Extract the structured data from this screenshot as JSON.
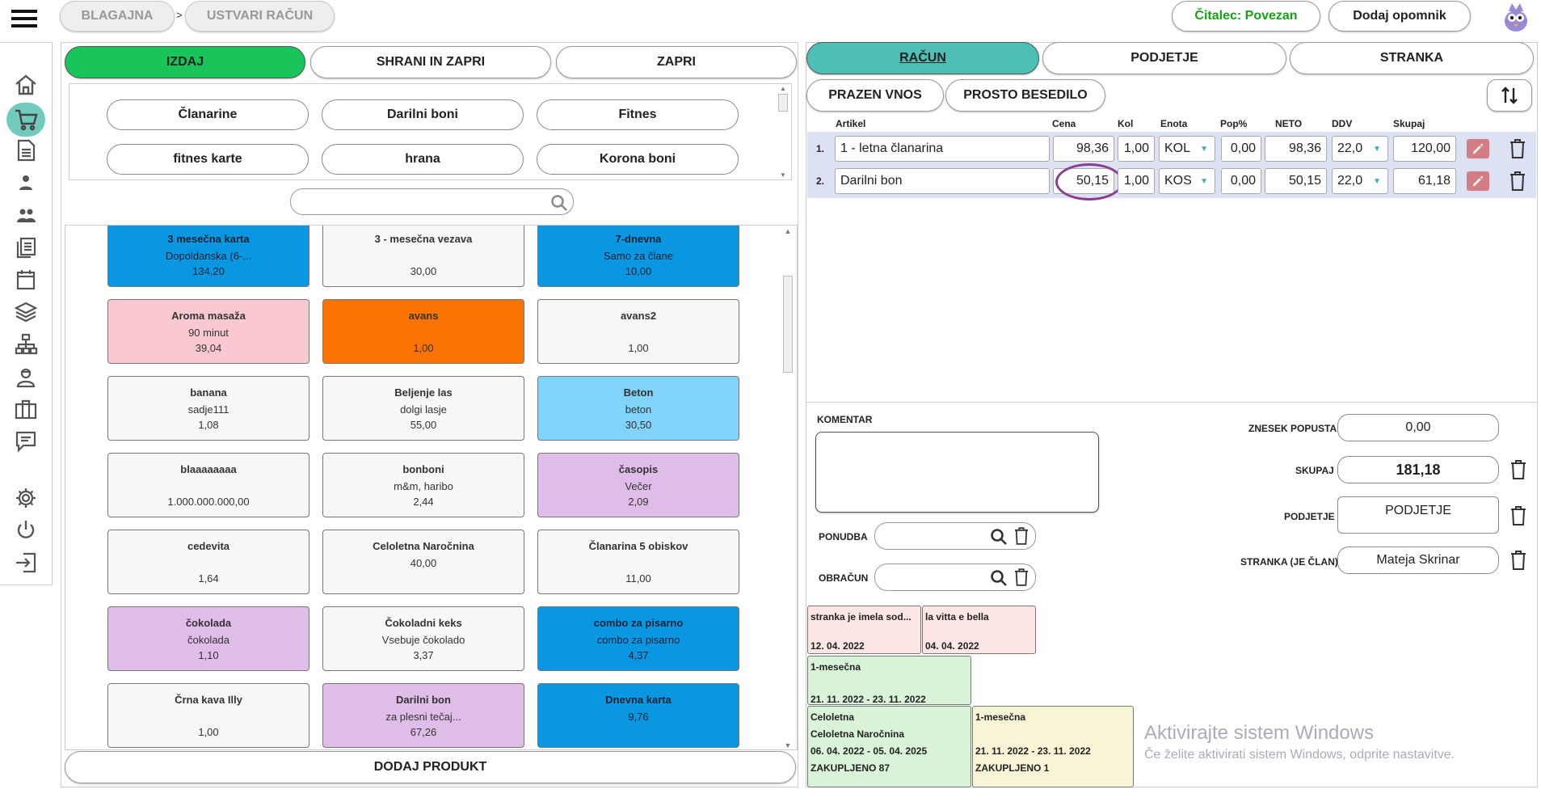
{
  "topbar": {
    "breadcrumb": [
      "BLAGAJNA",
      "USTVARI RAČUN"
    ],
    "separator": ">",
    "reader_status": "Čitalec: Povezan",
    "reminder_button": "Dodaj opomnik"
  },
  "colors": {
    "accent_green": "#19c45a",
    "accent_teal": "#4dbfb5",
    "reader_text": "#18a018"
  },
  "sidebar": {
    "icons": [
      "home-icon",
      "cart-icon",
      "document-icon",
      "person-icon",
      "people-icon",
      "copy-icon",
      "calendar-icon",
      "layers-icon",
      "sitemap-icon",
      "worker-icon",
      "briefcase-icon",
      "chat-icon",
      "gear-icon",
      "power-icon",
      "logout-icon"
    ]
  },
  "left": {
    "actions": {
      "issue": "IZDAJ",
      "save_close": "SHRANI IN ZAPRI",
      "close": "ZAPRI"
    },
    "categories": [
      "Članarine",
      "Darilni boni",
      "Fitnes",
      "fitnes karte",
      "hrana",
      "Korona boni"
    ],
    "search_value": "",
    "products": [
      {
        "name": "3 mesečna karta",
        "desc": "Dopoldanska (6-...",
        "price": "134,20",
        "color": "blue"
      },
      {
        "name": "3 - mesečna vezava",
        "desc": "",
        "price": "30,00",
        "color": "white"
      },
      {
        "name": "7-dnevna",
        "desc": "Samo za člane",
        "price": "10,00",
        "color": "blue"
      },
      {
        "name": "Aroma masaža",
        "desc": "90 minut",
        "price": "39,04",
        "color": "pink"
      },
      {
        "name": "avans",
        "desc": "",
        "price": "1,00",
        "color": "orange"
      },
      {
        "name": "avans2",
        "desc": "",
        "price": "1,00",
        "color": "white"
      },
      {
        "name": "banana",
        "desc": "sadje111",
        "price": "1,08",
        "color": "white"
      },
      {
        "name": "Beljenje las",
        "desc": "dolgi lasje",
        "price": "55,00",
        "color": "white"
      },
      {
        "name": "Beton",
        "desc": "beton",
        "price": "30,50",
        "color": "lblue"
      },
      {
        "name": "blaaaaaaaa",
        "desc": "",
        "price": "1.000.000.000,00",
        "color": "white"
      },
      {
        "name": "bonboni",
        "desc": "m&m, haribo",
        "price": "2,44",
        "color": "white"
      },
      {
        "name": "časopis",
        "desc": "Večer",
        "price": "2,09",
        "color": "purple"
      },
      {
        "name": "cedevita",
        "desc": "",
        "price": "1,64",
        "color": "white"
      },
      {
        "name": "Celoletna Naročnina",
        "desc": "40,00",
        "price": "",
        "color": "white"
      },
      {
        "name": "Članarina 5 obiskov",
        "desc": "",
        "price": "11,00",
        "color": "white"
      },
      {
        "name": "čokolada",
        "desc": "čokolada",
        "price": "1,10",
        "color": "purple"
      },
      {
        "name": "Čokoladni keks",
        "desc": "Vsebuje čokolado",
        "price": "3,37",
        "color": "white"
      },
      {
        "name": "combo za pisarno",
        "desc": "combo za pisarno",
        "price": "4,37",
        "color": "blue"
      },
      {
        "name": "Črna kava Illy",
        "desc": "",
        "price": "1,00",
        "color": "white"
      },
      {
        "name": "Darilni bon",
        "desc": "za plesni tečaj...",
        "price": "67,26",
        "color": "purple"
      },
      {
        "name": "Dnevna karta",
        "desc": "9,76",
        "price": "",
        "color": "blue"
      }
    ],
    "add_product": "DODAJ PRODUKT"
  },
  "right": {
    "tabs": {
      "invoice": "RAČUN",
      "split": "PODJETJE",
      "customer": "STRANKA"
    },
    "buttons": {
      "empty_entry": "PRAZEN VNOS",
      "free_text": "PROSTO BESEDILO"
    },
    "columns": [
      "Artikel",
      "Cena",
      "Kol",
      "Enota",
      "Pop%",
      "NETO",
      "DDV",
      "Skupaj"
    ],
    "rows": [
      {
        "num": "1.",
        "article": "1 - letna članarina",
        "price": "98,36",
        "qty": "1,00",
        "unit": "KOL",
        "discount": "0,00",
        "net": "98,36",
        "vat": "22,0",
        "total": "120,00"
      },
      {
        "num": "2.",
        "article": "Darilni bon",
        "price": "50,15",
        "qty": "1,00",
        "unit": "KOS",
        "discount": "0,00",
        "net": "50,15",
        "vat": "22,0",
        "total": "61,18"
      }
    ],
    "comment_label": "KOMENTAR",
    "comment_value": "",
    "offer_label": "PONUDBA",
    "billing_label": "OBRAČUN",
    "discount_label": "ZNESEK POPUSTA",
    "discount_value": "0,00",
    "total_label": "SKUPAJ",
    "total_value": "181,18",
    "company_label": "PODJETJE",
    "company_value": "PODJETJE",
    "customer_label": "STRANKA (JE ČLAN)",
    "customer_value": "Mateja Skrinar",
    "notes": [
      {
        "title": "stranka je imela sod...",
        "date": "12. 04. 2022"
      },
      {
        "title": "la vitta e bella",
        "date": "04. 04. 2022"
      }
    ],
    "memberships_row1": [
      {
        "lines": [
          "1-mesečna",
          "",
          "21. 11. 2022 - 23. 11. 2022"
        ]
      }
    ],
    "memberships_row2": [
      {
        "lines": [
          "Celoletna",
          "Celoletna Naročnina",
          "06. 04. 2022 - 05. 04. 2025",
          "ZAKUPLJENO 87"
        ]
      },
      {
        "lines": [
          "1-mesečna",
          "",
          "21. 11. 2022 - 23. 11. 2022",
          "ZAKUPLJENO 1"
        ]
      }
    ]
  },
  "watermark": {
    "title": "Aktivirajte sistem Windows",
    "subtitle": "Če želite aktivirati sistem Windows, odprite nastavitve."
  }
}
